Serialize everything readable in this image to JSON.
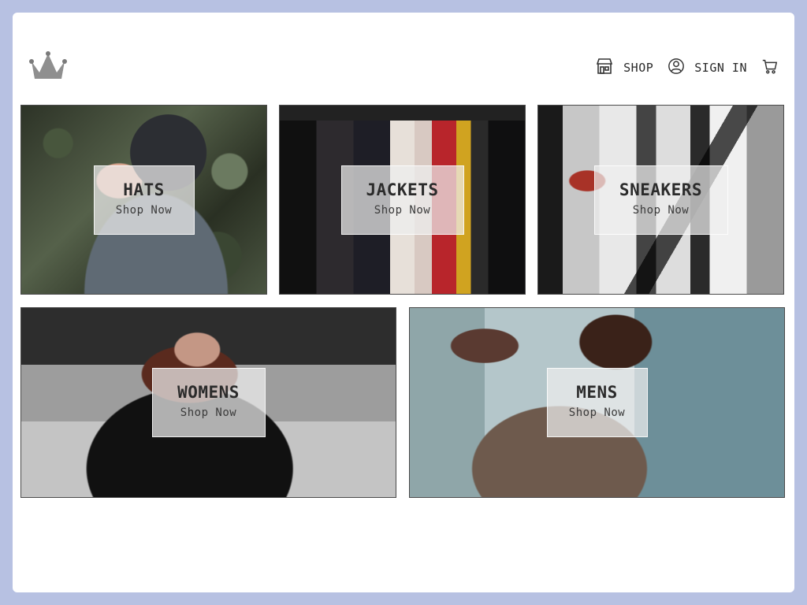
{
  "header": {
    "logo_icon": "crown-icon",
    "nav": {
      "shop_label": "SHOP",
      "shop_icon": "storefront-icon",
      "signin_label": "SIGN IN",
      "signin_icon": "user-circle-icon",
      "cart_icon": "shopping-cart-icon"
    }
  },
  "categories": [
    {
      "id": "hats",
      "title": "HATS",
      "cta": "Shop Now"
    },
    {
      "id": "jackets",
      "title": "JACKETS",
      "cta": "Shop Now"
    },
    {
      "id": "sneakers",
      "title": "SNEAKERS",
      "cta": "Shop Now"
    },
    {
      "id": "womens",
      "title": "WOMENS",
      "cta": "Shop Now"
    },
    {
      "id": "mens",
      "title": "MENS",
      "cta": "Shop Now"
    }
  ],
  "colors": {
    "page_background": "#b7c1e2",
    "card_background": "#ffffff",
    "text": "#2b2b2b"
  }
}
